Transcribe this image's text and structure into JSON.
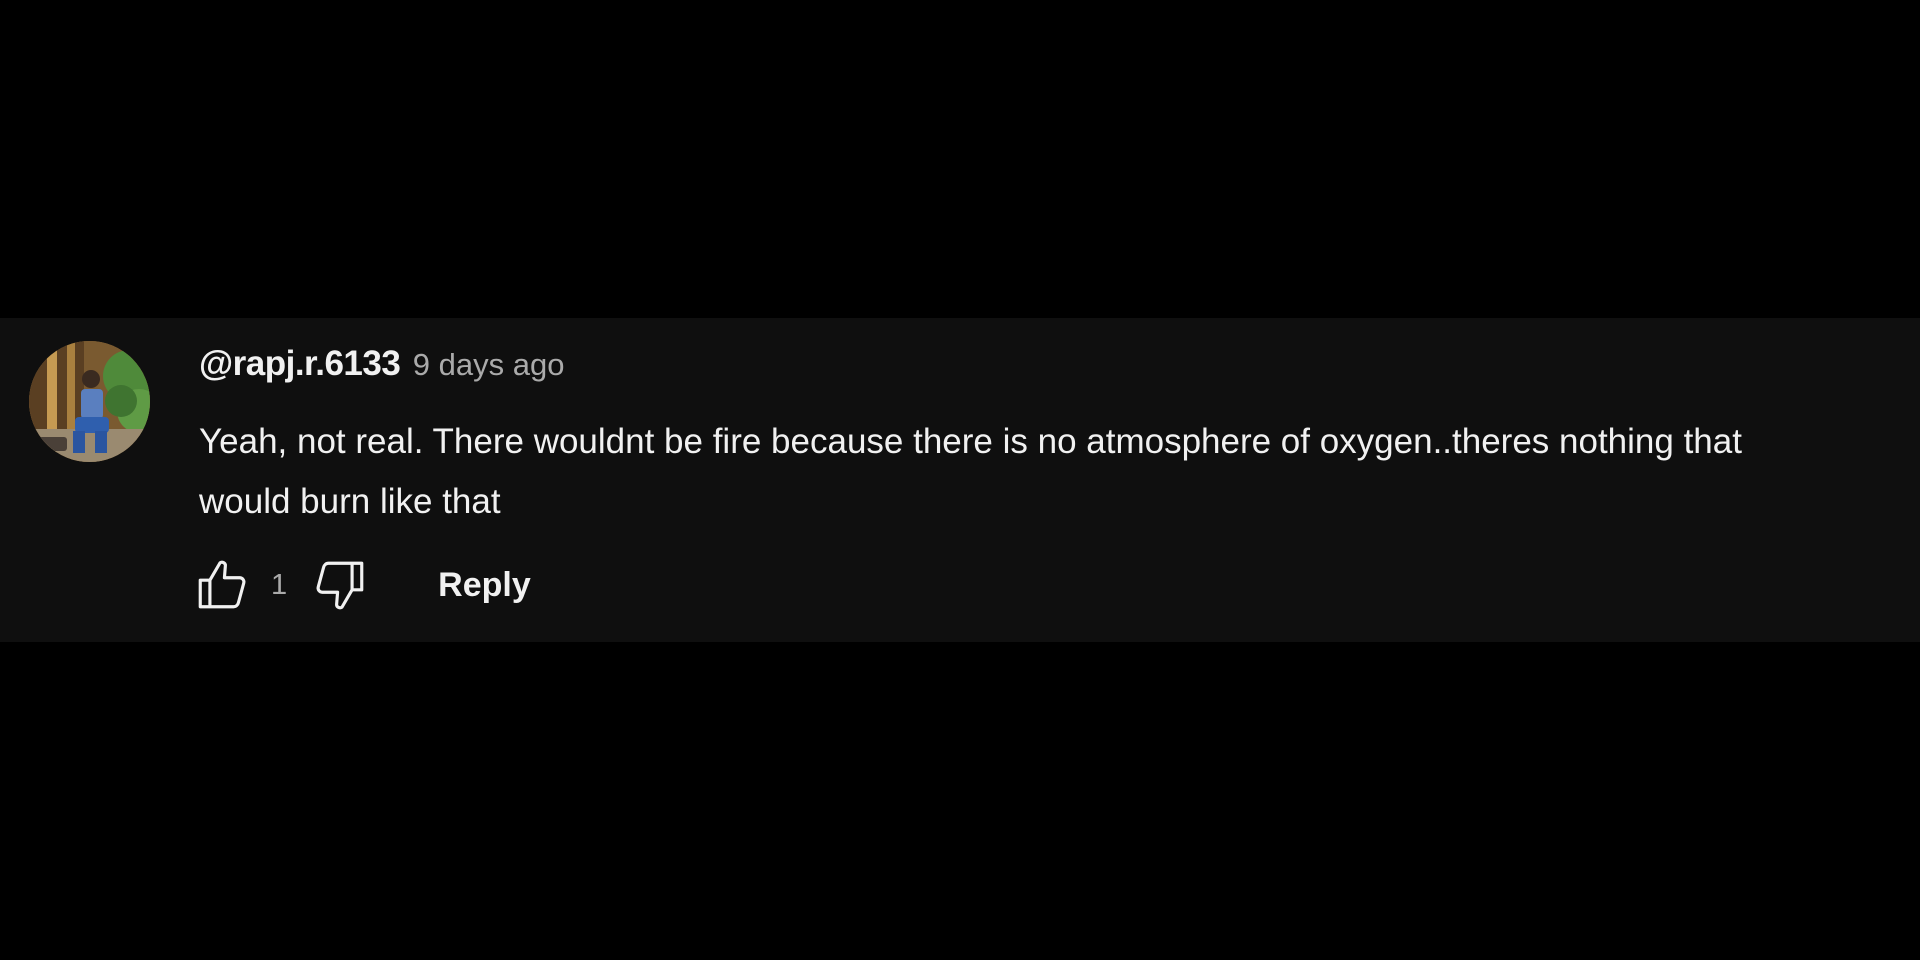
{
  "comment": {
    "author": "@rapj.r.6133",
    "timestamp": "9 days ago",
    "text": "Yeah, not real. There wouldnt be fire because there is no atmosphere of oxygen..theres nothing that would burn like that",
    "like_count": "1",
    "reply_label": "Reply"
  },
  "icons": {
    "like": "thumbs-up-outline",
    "dislike": "thumbs-down-outline"
  },
  "colors": {
    "page_background": "#000000",
    "card_background": "#0f0f0f",
    "primary_text": "#f1f1f1",
    "secondary_text": "#aaaaaa"
  }
}
